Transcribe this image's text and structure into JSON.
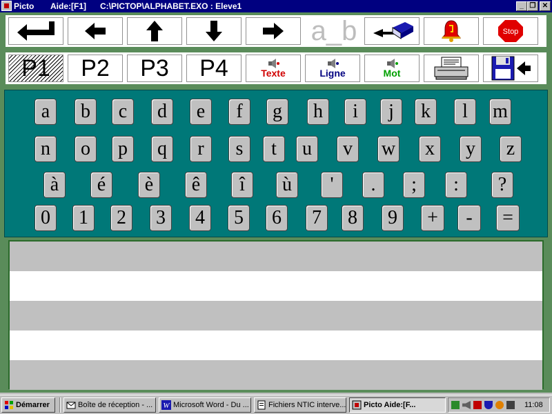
{
  "window": {
    "app_name": "Picto",
    "help": "Aide:[F1]",
    "path": "C:\\PICTOP\\ALPHABET.EXO : Eleve1"
  },
  "toolbar1": {
    "ab_label": "a_b",
    "stop_label": "Stop"
  },
  "toolbar2": {
    "pages": [
      "P1",
      "P2",
      "P3",
      "P4"
    ],
    "selected_page": "P1",
    "texte": "Texte",
    "ligne": "Ligne",
    "mot": "Mot"
  },
  "keyboard": {
    "rows": [
      [
        "a",
        "b",
        "c",
        "d",
        "e",
        "f",
        "g",
        "h",
        "i",
        "j",
        "k",
        "l",
        "m"
      ],
      [
        "n",
        "o",
        "p",
        "q",
        "r",
        "s",
        "t",
        "u",
        "v",
        "w",
        "x",
        "y",
        "z"
      ],
      [
        "à",
        "é",
        "è",
        "ê",
        "î",
        "ù",
        "'",
        ".",
        ";",
        ":",
        "?"
      ],
      [
        "0",
        "1",
        "2",
        "3",
        "4",
        "5",
        "6",
        "7",
        "8",
        "9",
        "+",
        "-",
        "="
      ]
    ]
  },
  "taskbar": {
    "start": "Démarrer",
    "tasks": [
      "Boîte de réception - ...",
      "Microsoft Word - Du ...",
      "Fichiers NTIC interve...",
      "Picto       Aide:[F..."
    ],
    "clock": "11:08"
  },
  "colors": {
    "title_bar": "#000080",
    "workspace": "#5a8c5a",
    "keyboard_bg": "#007878",
    "key": "#c0c0c0",
    "stripe_gray": "#c0c0c0"
  }
}
